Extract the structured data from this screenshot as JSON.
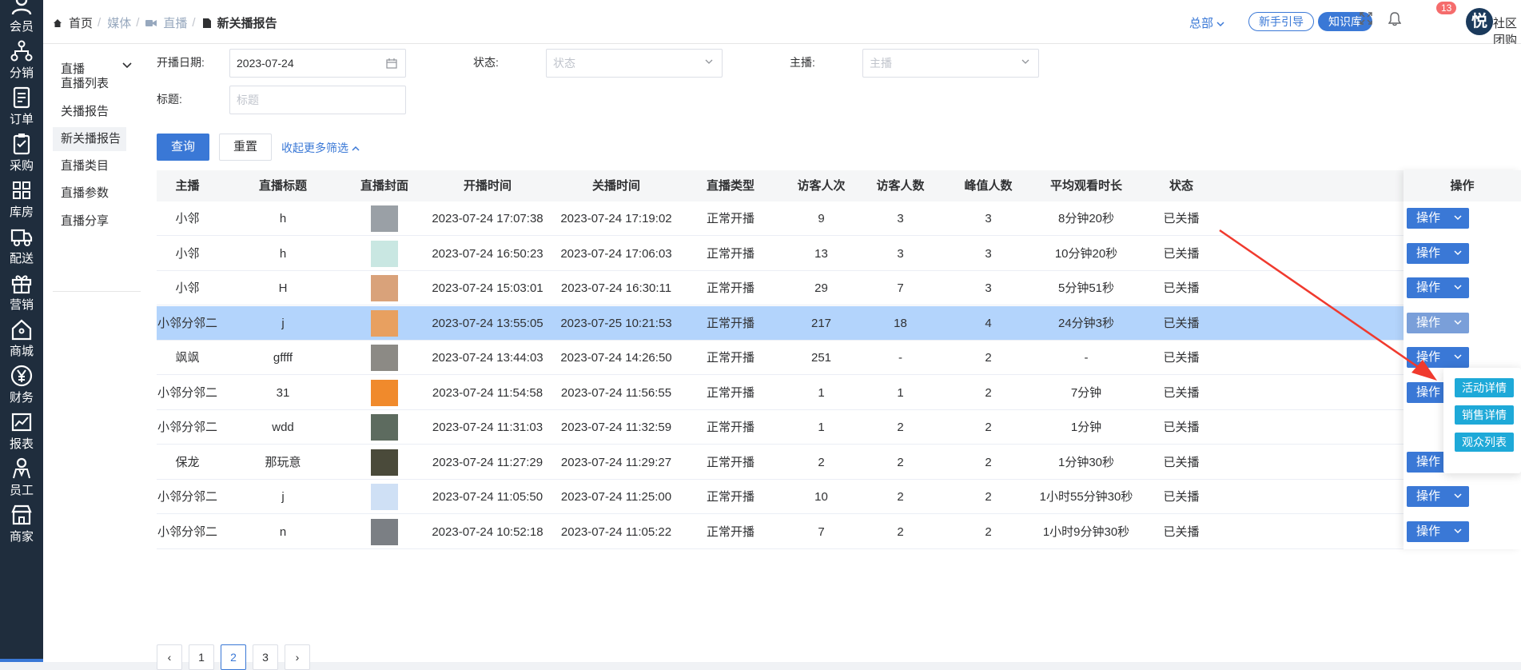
{
  "rail": {
    "items": [
      {
        "label": "会员",
        "icon": "user-icon"
      },
      {
        "label": "分销",
        "icon": "share-tree-icon"
      },
      {
        "label": "订单",
        "icon": "order-doc-icon"
      },
      {
        "label": "采购",
        "icon": "clipboard-icon"
      },
      {
        "label": "库房",
        "icon": "warehouse-grid-icon"
      },
      {
        "label": "配送",
        "icon": "truck-icon"
      },
      {
        "label": "营销",
        "icon": "gift-icon"
      },
      {
        "label": "商城",
        "icon": "home-icon"
      },
      {
        "label": "财务",
        "icon": "yen-icon"
      },
      {
        "label": "报表",
        "icon": "chart-line-icon"
      },
      {
        "label": "员工",
        "icon": "staff-icon"
      },
      {
        "label": "商家",
        "icon": "store-icon"
      }
    ]
  },
  "header": {
    "breadcrumb": {
      "home": "首页",
      "media": "媒体",
      "live": "直播",
      "current": "新关播报告"
    },
    "region": "总部",
    "guide_btn": "新手引导",
    "kb_btn": "知识库",
    "notify_count": "13",
    "avatar_char": "悦",
    "user_name": "社区团购"
  },
  "submenu": {
    "group": "直播",
    "items": [
      "直播列表",
      "关播报告",
      "新关播报告",
      "直播类目",
      "直播参数",
      "直播分享"
    ],
    "active": "新关播报告"
  },
  "filters": {
    "start_date_label": "开播日期:",
    "start_date_value": "2023-07-24",
    "status_label": "状态:",
    "status_placeholder": "状态",
    "anchor_label": "主播:",
    "anchor_placeholder": "主播",
    "title_label": "标题:",
    "title_placeholder": "标题",
    "query_btn": "查询",
    "reset_btn": "重置",
    "collapse_link": "收起更多筛选"
  },
  "table": {
    "headers": [
      "主播",
      "直播标题",
      "直播封面",
      "开播时间",
      "关播时间",
      "直播类型",
      "访客人次",
      "访客人数",
      "峰值人数",
      "平均观看时长",
      "状态",
      "操作"
    ],
    "op_label": "操作",
    "rows": [
      {
        "anchor": "小邻",
        "title": "h",
        "cover": "#9aa0a6",
        "start": "2023-07-24 17:07:38",
        "end": "2023-07-24 17:19:02",
        "type": "正常开播",
        "pv": "9",
        "uv": "3",
        "peak": "3",
        "avg": "8分钟20秒",
        "status": "已关播"
      },
      {
        "anchor": "小邻",
        "title": "h",
        "cover": "#c9e7e2",
        "start": "2023-07-24 16:50:23",
        "end": "2023-07-24 17:06:03",
        "type": "正常开播",
        "pv": "13",
        "uv": "3",
        "peak": "3",
        "avg": "10分钟20秒",
        "status": "已关播"
      },
      {
        "anchor": "小邻",
        "title": "H",
        "cover": "#d9a27a",
        "start": "2023-07-24 15:03:01",
        "end": "2023-07-24 16:30:11",
        "type": "正常开播",
        "pv": "29",
        "uv": "7",
        "peak": "3",
        "avg": "5分钟51秒",
        "status": "已关播"
      },
      {
        "anchor": "小邻分邻二",
        "title": "j",
        "cover": "#e8a060",
        "start": "2023-07-24 13:55:05",
        "end": "2023-07-25 10:21:53",
        "type": "正常开播",
        "pv": "217",
        "uv": "18",
        "peak": "4",
        "avg": "24分钟3秒",
        "status": "已关播"
      },
      {
        "anchor": "飒飒",
        "title": "gffff",
        "cover": "#8c8a85",
        "start": "2023-07-24 13:44:03",
        "end": "2023-07-24 14:26:50",
        "type": "正常开播",
        "pv": "251",
        "uv": "-",
        "peak": "2",
        "avg": "-",
        "status": "已关播"
      },
      {
        "anchor": "小邻分邻二",
        "title": "31",
        "cover": "#f08a2c",
        "start": "2023-07-24 11:54:58",
        "end": "2023-07-24 11:56:55",
        "type": "正常开播",
        "pv": "1",
        "uv": "1",
        "peak": "2",
        "avg": "7分钟",
        "status": "已关播"
      },
      {
        "anchor": "小邻分邻二",
        "title": "wdd",
        "cover": "#5d6b5f",
        "start": "2023-07-24 11:31:03",
        "end": "2023-07-24 11:32:59",
        "type": "正常开播",
        "pv": "1",
        "uv": "2",
        "peak": "2",
        "avg": "1分钟",
        "status": "已关播"
      },
      {
        "anchor": "保龙",
        "title": "那玩意",
        "cover": "#4a4a3a",
        "start": "2023-07-24 11:27:29",
        "end": "2023-07-24 11:29:27",
        "type": "正常开播",
        "pv": "2",
        "uv": "2",
        "peak": "2",
        "avg": "1分钟30秒",
        "status": "已关播"
      },
      {
        "anchor": "小邻分邻二",
        "title": "j",
        "cover": "#cfe0f5",
        "start": "2023-07-24 11:05:50",
        "end": "2023-07-24 11:25:00",
        "type": "正常开播",
        "pv": "10",
        "uv": "2",
        "peak": "2",
        "avg": "1小时55分钟30秒",
        "status": "已关播"
      },
      {
        "anchor": "小邻分邻二",
        "title": "n",
        "cover": "#7b7f84",
        "start": "2023-07-24 10:52:18",
        "end": "2023-07-24 11:05:22",
        "type": "正常开播",
        "pv": "7",
        "uv": "2",
        "peak": "2",
        "avg": "1小时9分钟30秒",
        "status": "已关播"
      }
    ],
    "highlighted_row": 3
  },
  "dropdown": {
    "items": [
      "活动详情",
      "销售详情",
      "观众列表"
    ]
  },
  "pager": {
    "prev": "‹",
    "pages": [
      "1",
      "2",
      "3"
    ],
    "current": "2",
    "next": "›"
  },
  "colors": {
    "primary": "#3a78d6",
    "dropdown_item": "#1ea9d8",
    "highlight_row": "#b3d4fc",
    "arrow": "#f03a2e"
  }
}
